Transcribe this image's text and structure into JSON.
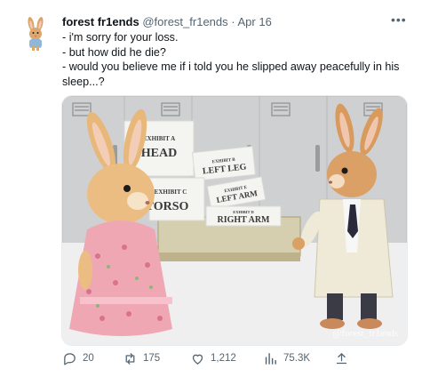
{
  "tweet": {
    "display_name": "forest fr1ends",
    "handle": "@forest_fr1ends",
    "separator": "·",
    "date": "Apr 16",
    "more_label": "•••",
    "lines": [
      "- i'm sorry for your loss.",
      "- but how did he die?",
      "- would you believe me if i told you he slipped away peacefully in his",
      "sleep...?"
    ]
  },
  "media": {
    "blocks": {
      "head_small": "EXHIBIT A",
      "head_big": "HEAD",
      "leftleg_small": "EXHIBIT B",
      "leftleg_big": "LEFT LEG",
      "torso_small": "EXHIBIT C",
      "torso_big": "TORSO",
      "leftarm_small": "EXHIBIT E",
      "leftarm_big": "LEFT ARM",
      "rightarm_small": "EXHIBIT D",
      "rightarm_big": "RIGHT ARM"
    },
    "watermark": "@forest_fr1ends"
  },
  "actions": {
    "replies": "20",
    "retweets": "175",
    "likes": "1,212",
    "views": "75.3K"
  }
}
